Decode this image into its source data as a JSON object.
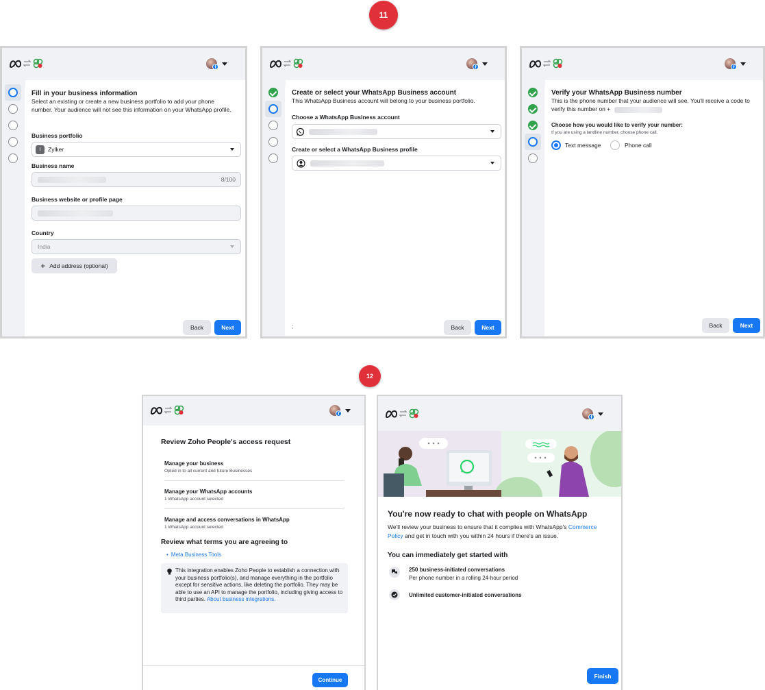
{
  "badges": {
    "step11": "11",
    "step12": "12"
  },
  "colors": {
    "accent": "#1877f2",
    "success": "#31a24c",
    "badge": "#e0313a",
    "panel_bg": "#f0f2f5"
  },
  "icons": {
    "header": [
      "meta-logo-icon",
      "swap-arrows-icon",
      "partner-app-icon"
    ],
    "account": [
      "avatar",
      "facebook-icon",
      "caret-down-icon"
    ]
  },
  "panel1": {
    "title": "Fill in your business information",
    "description": "Select an existing or create a new business portfolio to add your phone number. Your audience will not see this information on your WhatsApp profile.",
    "portfolio_label": "Business portfolio",
    "portfolio_initial": "I",
    "portfolio_value": "Zylker",
    "business_name_label": "Business name",
    "business_name_counter": "8/100",
    "website_label": "Business website or profile page",
    "country_label": "Country",
    "country_value": "India",
    "add_address": "Add address (optional)",
    "back": "Back",
    "next": "Next"
  },
  "panel2": {
    "title": "Create or select your WhatsApp Business account",
    "description": "This WhatsApp Business account will belong to your business portfolio.",
    "account_label": "Choose a WhatsApp Business account",
    "profile_label": "Create or select a WhatsApp Business profile",
    "footnote": ";",
    "back": "Back",
    "next": "Next"
  },
  "panel3": {
    "title": "Verify your WhatsApp Business number",
    "description_line1": "This is the phone number that your audience will see. You'll receive a code to",
    "description_line2": "verify this number on +",
    "method_label": "Choose how you would like to verify your number:",
    "method_hint": "If you are using a landline number, choose phone call.",
    "option_text": "Text message",
    "option_call": "Phone call",
    "back": "Back",
    "next": "Next"
  },
  "panel4": {
    "title": "Review Zoho People's access request",
    "permissions": [
      {
        "title": "Manage your business",
        "detail": "Opted in to all current and future Businesses"
      },
      {
        "title": "Manage your WhatsApp accounts",
        "detail": "1 WhatsApp account selected"
      },
      {
        "title": "Manage and access conversations in WhatsApp",
        "detail": "1 WhatsApp account selected"
      }
    ],
    "terms_title": "Review what terms you are agreeing to",
    "terms_link": "Meta Business Tools",
    "notice_text": "This integration enables Zoho People to establish a connection with your business portfolio(s), and manage everything in the portfolio except for sensitive actions, like deleting the portfolio. They may be able to use an API to manage the portfolio, including giving access to third parties.",
    "notice_link": "About business integrations.",
    "continue": "Continue"
  },
  "panel5": {
    "title": "You're now ready to chat with people on WhatsApp",
    "intro_before": "We'll review your business to ensure that it complies with WhatsApp's ",
    "intro_link": "Commerce Policy",
    "intro_after": " and get in touch with you within 24 hours if there's an issue.",
    "start_title": "You can immediately get started with",
    "features": [
      {
        "title": "250 business-initiated conversations",
        "detail": "Per phone number in a rolling 24-hour period"
      },
      {
        "title": "Unlimited customer-initiated conversations",
        "detail": ""
      }
    ],
    "finish": "Finish"
  }
}
